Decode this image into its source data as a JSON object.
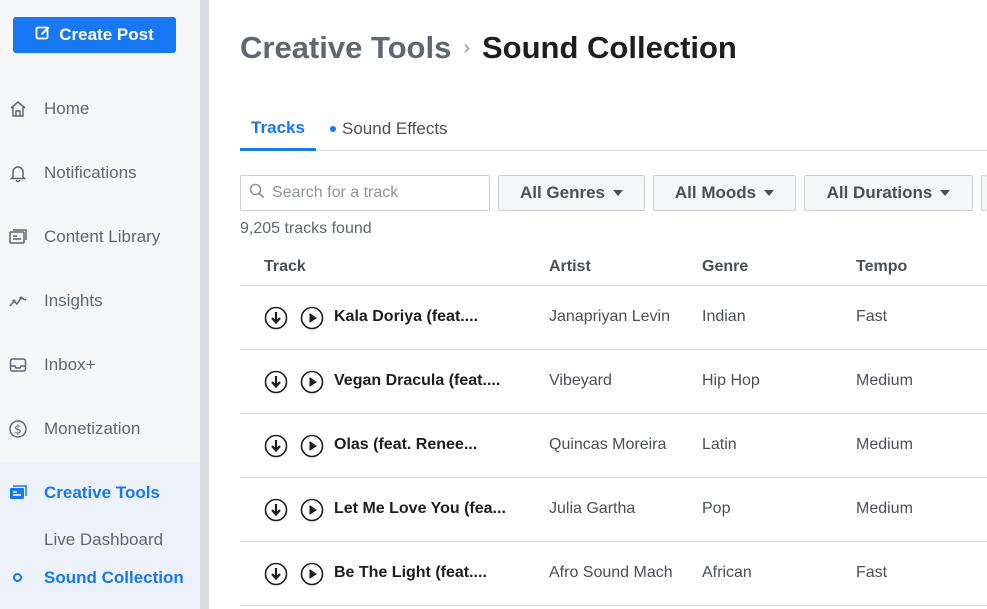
{
  "sidebar": {
    "create_post": "Create Post",
    "items": [
      {
        "label": "Home",
        "icon": "home-icon"
      },
      {
        "label": "Notifications",
        "icon": "bell-icon"
      },
      {
        "label": "Content Library",
        "icon": "content-library-icon"
      },
      {
        "label": "Insights",
        "icon": "insights-icon"
      },
      {
        "label": "Inbox+",
        "icon": "inbox-icon"
      },
      {
        "label": "Monetization",
        "icon": "dollar-icon"
      },
      {
        "label": "Creative Tools",
        "icon": "creative-tools-icon",
        "active": true
      }
    ],
    "subitems": [
      {
        "label": "Live Dashboard"
      },
      {
        "label": "Sound Collection",
        "active": true
      }
    ]
  },
  "breadcrumb": {
    "parent": "Creative Tools",
    "separator": "›",
    "current": "Sound Collection"
  },
  "tabs": [
    {
      "label": "Tracks",
      "active": true
    },
    {
      "label": "Sound Effects",
      "has_dot": true
    }
  ],
  "search": {
    "placeholder": "Search for a track"
  },
  "filters": [
    {
      "label": "All Genres"
    },
    {
      "label": "All Moods"
    },
    {
      "label": "All Durations"
    }
  ],
  "results_count": "9,205 tracks found",
  "table": {
    "headers": [
      "Track",
      "Artist",
      "Genre",
      "Tempo"
    ],
    "rows": [
      {
        "title": "Kala Doriya (feat....",
        "artist": "Janapriyan Levin",
        "genre": "Indian",
        "tempo": "Fast"
      },
      {
        "title": "Vegan Dracula (feat....",
        "artist": "Vibeyard",
        "genre": "Hip Hop",
        "tempo": "Medium"
      },
      {
        "title": "Olas (feat. Renee...",
        "artist": "Quincas Moreira",
        "genre": "Latin",
        "tempo": "Medium"
      },
      {
        "title": "Let Me Love You (fea...",
        "artist": "Julia Gartha",
        "genre": "Pop",
        "tempo": "Medium"
      },
      {
        "title": "Be The Light (feat....",
        "artist": "Afro Sound Mach",
        "genre": "African",
        "tempo": "Fast"
      }
    ]
  },
  "colors": {
    "accent": "#1877f2",
    "text": "#1c1e21",
    "muted": "#606770"
  }
}
